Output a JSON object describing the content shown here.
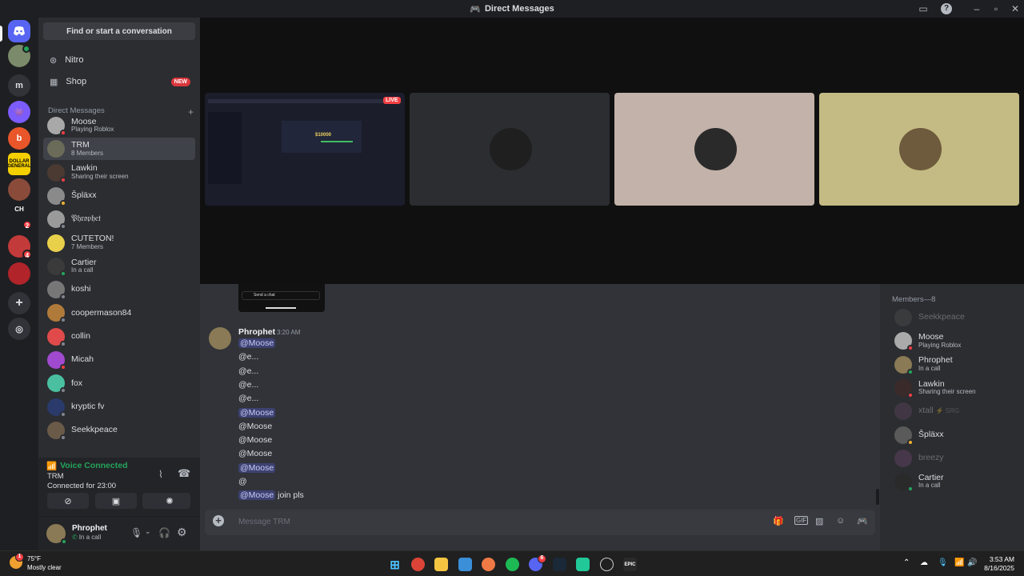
{
  "window": {
    "title": "Direct Messages"
  },
  "servers": {
    "m_label": "m",
    "ch_label": "CH",
    "dollar_label": "DOLLAR GENERAL",
    "badge_1": "2",
    "badge_2": "4"
  },
  "dm_panel": {
    "search_placeholder": "Find or start a conversation",
    "nitro": "Nitro",
    "shop": "Shop",
    "shop_badge": "NEW",
    "section_title": "Direct Messages",
    "add_icon": "+",
    "items": [
      {
        "name": "Moose",
        "sub": "Playing Roblox",
        "status": "dnd"
      },
      {
        "name": "TRM",
        "sub": "8 Members",
        "status": "group"
      },
      {
        "name": "Lawkin",
        "sub": "Sharing their screen",
        "status": "dnd"
      },
      {
        "name": "Špläxx",
        "sub": "",
        "status": "idle"
      },
      {
        "name": "𝔓𝔥𝔯𝔬𝔭𝔥𝔢𝔱",
        "sub": "",
        "status": "offline"
      },
      {
        "name": "CUTETON!",
        "sub": "7 Members",
        "status": "group"
      },
      {
        "name": "Cartier",
        "sub": "In a call",
        "status": "online"
      },
      {
        "name": "koshi",
        "sub": "",
        "status": "offline"
      },
      {
        "name": "coopermason84",
        "sub": "",
        "status": "offline"
      },
      {
        "name": "collin",
        "sub": "",
        "status": "offline"
      },
      {
        "name": "Micah",
        "sub": "",
        "status": "dnd"
      },
      {
        "name": "fox",
        "sub": "",
        "status": "offline"
      },
      {
        "name": "kryptic fv",
        "sub": "",
        "status": "offline"
      },
      {
        "name": "Seekkpeace",
        "sub": "",
        "status": "offline"
      }
    ]
  },
  "voice": {
    "title": "Voice Connected",
    "channel": "TRM",
    "duration": "Connected for 23:00"
  },
  "user": {
    "name": "Phrophet",
    "status": "In a call"
  },
  "stream": {
    "live_badge": "LIVE",
    "tile_value": "$10000"
  },
  "chat": {
    "embed_input": "Send a chat",
    "author": "Phrophet",
    "time": "3:20 AM",
    "lines": [
      {
        "text": "@Moose",
        "mention": true,
        "suffix": ""
      },
      {
        "text": "@e...",
        "mention": false,
        "suffix": ""
      },
      {
        "text": "@e...",
        "mention": false,
        "suffix": ""
      },
      {
        "text": "@e...",
        "mention": false,
        "suffix": ""
      },
      {
        "text": "@e...",
        "mention": false,
        "suffix": ""
      },
      {
        "text": "@Moose",
        "mention": true,
        "suffix": ""
      },
      {
        "text": "@Moose",
        "mention": false,
        "suffix": ""
      },
      {
        "text": "@Moose",
        "mention": false,
        "suffix": ""
      },
      {
        "text": "@Moose",
        "mention": false,
        "suffix": ""
      },
      {
        "text": "@Moose",
        "mention": true,
        "suffix": ""
      },
      {
        "text": "@",
        "mention": false,
        "suffix": ""
      },
      {
        "text": "@Moose",
        "mention": true,
        "suffix": " join pls"
      }
    ],
    "input_placeholder": "Message TRM"
  },
  "members": {
    "title": "Members—8",
    "items": [
      {
        "name": "Seekkpeace",
        "sub": "",
        "dim": true
      },
      {
        "name": "Moose",
        "sub": "Playing Roblox",
        "dim": false
      },
      {
        "name": "Phrophet",
        "sub": "In a call",
        "dim": false
      },
      {
        "name": "Lawkin",
        "sub": "Sharing their screen",
        "dim": false
      },
      {
        "name": "xtall",
        "sub": "",
        "tag": "⚡ SRG",
        "dim": true
      },
      {
        "name": "Špläxx",
        "sub": "",
        "dim": false
      },
      {
        "name": "breezy",
        "sub": "",
        "dim": true
      },
      {
        "name": "Cartier",
        "sub": "In a call",
        "dim": false
      }
    ]
  },
  "taskbar": {
    "weather_temp": "75°F",
    "weather_desc": "Mostly clear",
    "weather_badge": "1",
    "discord_badge": "6",
    "epic_label": "EPIC",
    "time": "3:53 AM",
    "date": "8/16/2025"
  },
  "colors": {
    "blurple": "#5865f2",
    "green": "#23a55a",
    "red": "#f23f43",
    "idle": "#f0b232"
  }
}
